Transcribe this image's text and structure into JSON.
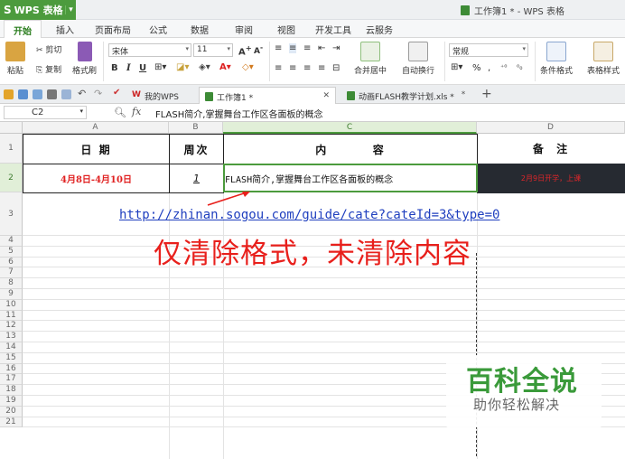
{
  "app": {
    "name": "WPS 表格",
    "window_title": "工作簿1 * - WPS 表格"
  },
  "menu_tabs": [
    "开始",
    "插入",
    "页面布局",
    "公式",
    "数据",
    "审阅",
    "视图",
    "开发工具",
    "云服务"
  ],
  "ribbon": {
    "paste": "粘贴",
    "cut": "剪切",
    "copy": "复制",
    "format_painter": "格式刷",
    "font_name": "宋体",
    "font_size": "11",
    "merge_center": "合并居中",
    "wrap_text": "自动换行",
    "number_format": "常规",
    "conditional_format": "条件格式",
    "table_style": "表格样式",
    "bold": "B",
    "italic": "I",
    "underline": "U",
    "percent": "%"
  },
  "doc_tabs": [
    {
      "label": "我的WPS",
      "active": false
    },
    {
      "label": "工作簿1 *",
      "active": true
    },
    {
      "label": "动画FLASH教学计划.xls *",
      "active": false
    }
  ],
  "formula_bar": {
    "cell_ref": "C2",
    "fx": "fx",
    "content": "FLASH简介,掌握舞台工作区各面板的概念"
  },
  "columns": [
    "A",
    "B",
    "C",
    "D"
  ],
  "rows": [
    "1",
    "2",
    "3",
    "4",
    "5",
    "6",
    "7",
    "8",
    "9",
    "10",
    "11",
    "12",
    "13",
    "14",
    "15",
    "16",
    "17",
    "18",
    "19",
    "20",
    "21"
  ],
  "table": {
    "headers": [
      "日  期",
      "周次",
      "内        容",
      "备  注"
    ],
    "row2": {
      "date": "4月8日-4月10日",
      "week": "1",
      "content": "FLASH简介,掌握舞台工作区各面板的概念",
      "note": "2月9日开学，上课"
    }
  },
  "link": "http://zhinan.sogou.com/guide/cate?cateId=3&type=0",
  "annotation": "仅清除格式，未清除内容",
  "watermark": {
    "title": "百科全说",
    "subtitle": "助你轻松解决"
  },
  "colors": {
    "accent": "#4c9b3d",
    "annotation": "#e8201c",
    "link": "#1f3fbf"
  }
}
